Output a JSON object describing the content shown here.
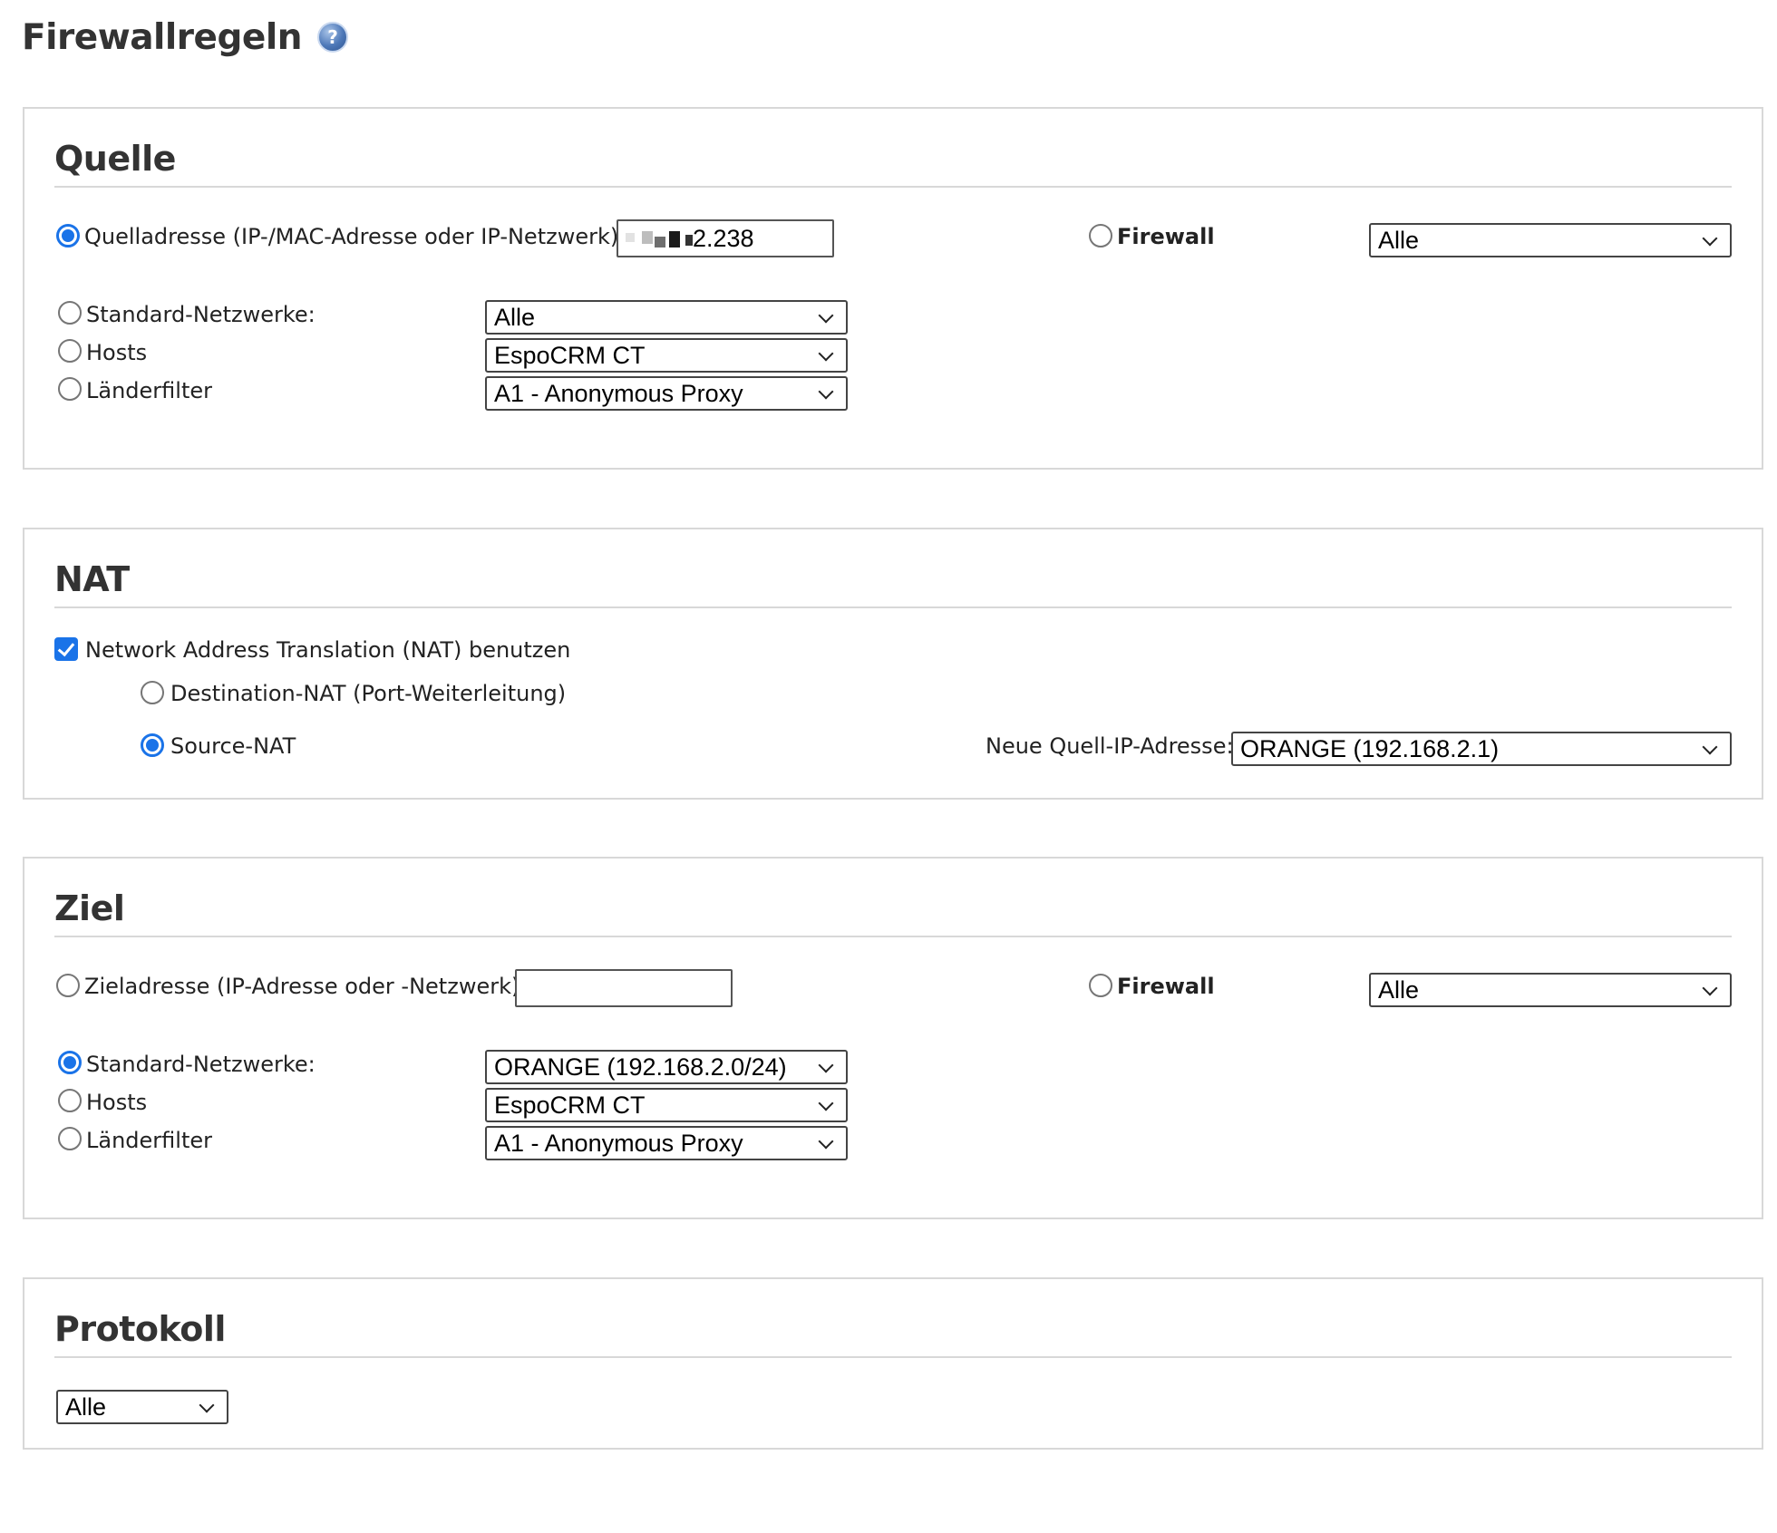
{
  "page": {
    "title": "Firewallregeln",
    "help_icon": "question-mark-icon"
  },
  "quelle": {
    "title": "Quelle",
    "source_address": {
      "label": "Quelladresse (IP-/MAC-Adresse oder IP-Netzwerk):",
      "checked": true,
      "value": "2.238"
    },
    "firewall": {
      "label": "Firewall",
      "checked": false,
      "select_value": "Alle"
    },
    "standard_networks": {
      "label": "Standard-Netzwerke:",
      "checked": false,
      "select_value": "Alle"
    },
    "hosts": {
      "label": "Hosts",
      "checked": false,
      "select_value": "EspoCRM CT"
    },
    "country_filter": {
      "label": "Länderfilter",
      "checked": false,
      "select_value": "A1 - Anonymous Proxy"
    }
  },
  "nat": {
    "title": "NAT",
    "use_nat": {
      "label": "Network Address Translation (NAT) benutzen",
      "checked": true
    },
    "destination_nat": {
      "label": "Destination-NAT (Port-Weiterleitung)",
      "checked": false
    },
    "source_nat": {
      "label": "Source-NAT",
      "checked": true
    },
    "new_source_ip": {
      "label": "Neue Quell-IP-Adresse:",
      "select_value": "ORANGE (192.168.2.1)"
    }
  },
  "ziel": {
    "title": "Ziel",
    "destination_address": {
      "label": "Zieladresse (IP-Adresse oder -Netzwerk):",
      "checked": false,
      "value": ""
    },
    "firewall": {
      "label": "Firewall",
      "checked": false,
      "select_value": "Alle"
    },
    "standard_networks": {
      "label": "Standard-Netzwerke:",
      "checked": true,
      "select_value": "ORANGE (192.168.2.0/24)"
    },
    "hosts": {
      "label": "Hosts",
      "checked": false,
      "select_value": "EspoCRM CT"
    },
    "country_filter": {
      "label": "Länderfilter",
      "checked": false,
      "select_value": "A1 - Anonymous Proxy"
    }
  },
  "protokoll": {
    "title": "Protokoll",
    "select_value": "Alle"
  },
  "colors": {
    "accent": "#1a73e8",
    "heading": "#333333",
    "border": "#d8d8d8"
  }
}
